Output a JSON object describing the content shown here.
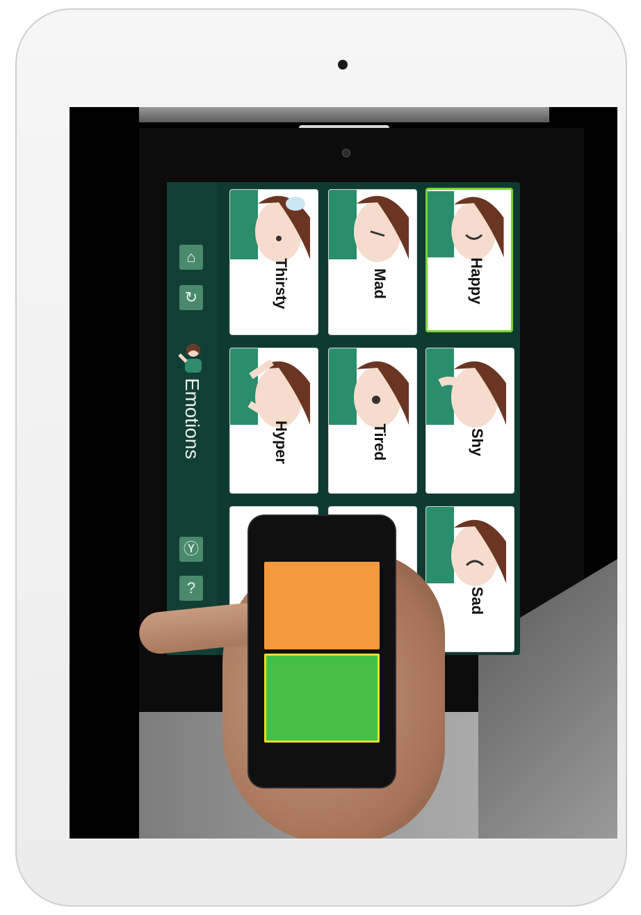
{
  "app": {
    "category_title": "Emotions",
    "nav_icons": [
      "home-icon",
      "back-icon",
      "category-avatar-icon",
      "tool-icon",
      "help-icon"
    ]
  },
  "cards": [
    {
      "label": "Thirsty",
      "selected": false
    },
    {
      "label": "Mad",
      "selected": false
    },
    {
      "label": "Happy",
      "selected": true
    },
    {
      "label": "Hyper",
      "selected": false
    },
    {
      "label": "Tired",
      "selected": false
    },
    {
      "label": "Shy",
      "selected": false
    },
    {
      "label": "",
      "selected": false
    },
    {
      "label": "",
      "selected": false
    },
    {
      "label": "Sad",
      "selected": false
    }
  ],
  "colors": {
    "app_background": "#0f3a31",
    "selected_border": "#78d42a",
    "switch_orange": "#f39a3c",
    "switch_green": "#45c045",
    "switch_focus_border": "#e6e02d"
  },
  "switch_device": {
    "buttons": [
      "orange-switch",
      "green-switch"
    ],
    "focused": "green-switch"
  }
}
